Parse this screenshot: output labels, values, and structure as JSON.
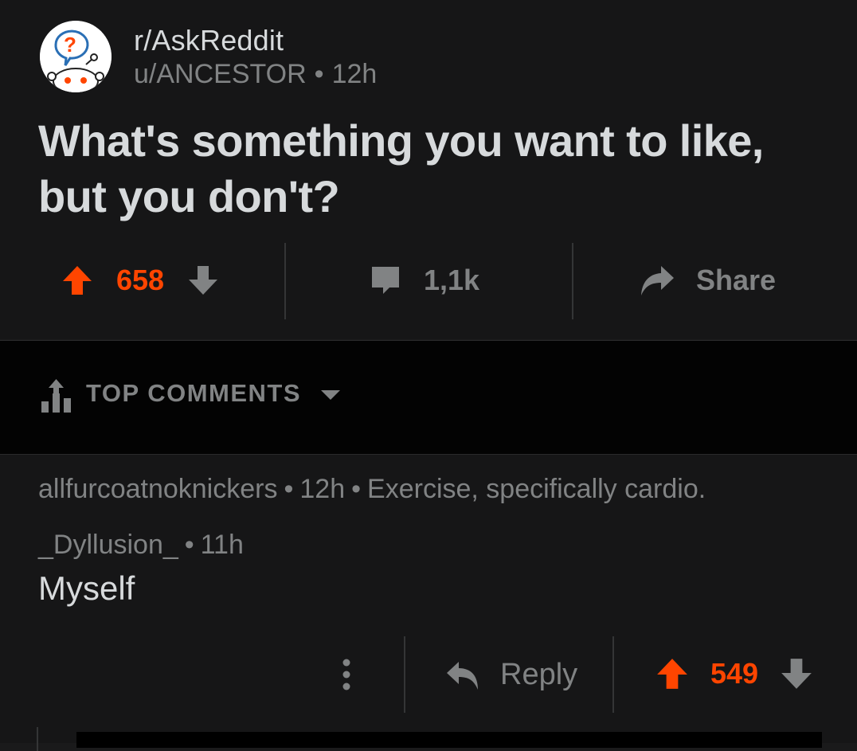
{
  "post": {
    "subreddit": "r/AskReddit",
    "author": "u/ANCESTOR",
    "age": "12h",
    "title": "What's something you want to like, but you don't?",
    "score": "658",
    "comments_count": "1,1k",
    "share_label": "Share",
    "avatar_icon": "askreddit-snoo-icon"
  },
  "sort": {
    "label": "TOP COMMENTS",
    "icon": "sort-bars-icon"
  },
  "comments": [
    {
      "author": "allfurcoatnoknickers",
      "age": "12h",
      "body": "Exercise, specifically cardio."
    },
    {
      "author": "_Dyllusion_",
      "age": "11h",
      "body": "Myself",
      "reply_label": "Reply",
      "score": "549"
    }
  ],
  "colors": {
    "upvote": "#ff4500",
    "muted": "#818384",
    "text": "#d7dadc",
    "background": "#161617"
  },
  "separator": "•"
}
